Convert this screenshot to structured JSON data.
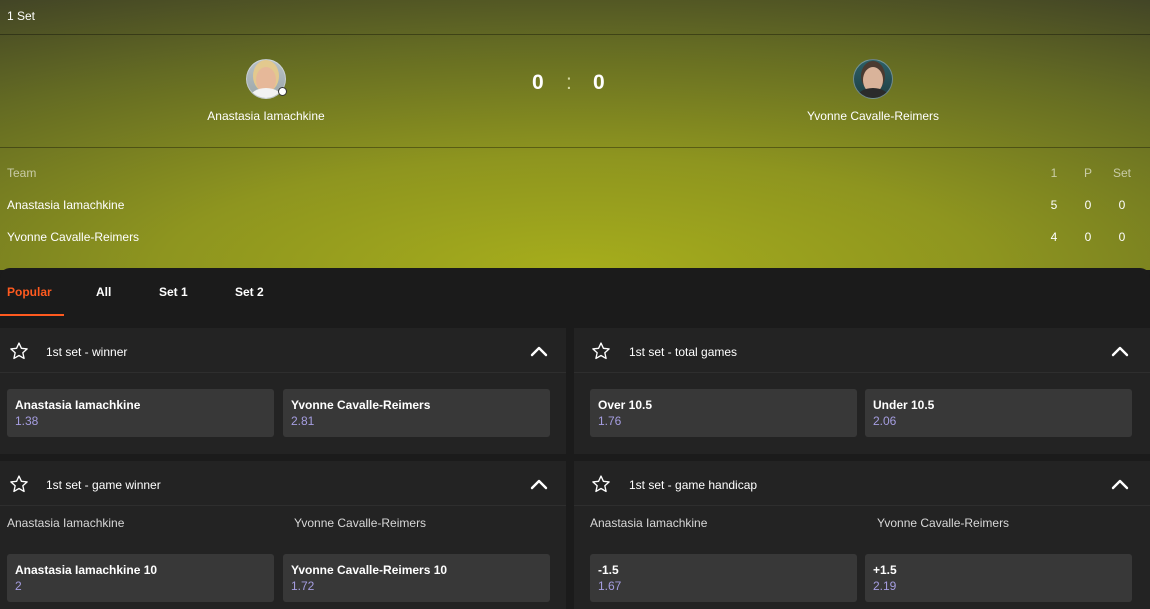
{
  "header": {
    "set_label": "1 Set",
    "home": {
      "name": "Anastasia Iamachkine",
      "score": "0"
    },
    "away": {
      "name": "Yvonne Cavalle-Reimers",
      "score": "0"
    },
    "separator": ":"
  },
  "scoreboard": {
    "headers": {
      "team": "Team",
      "c1": "1",
      "c2": "P",
      "c3": "Set"
    },
    "rows": [
      {
        "name": "Anastasia Iamachkine",
        "c1": "5",
        "c2": "0",
        "c3": "0"
      },
      {
        "name": "Yvonne Cavalle-Reimers",
        "c1": "4",
        "c2": "0",
        "c3": "0"
      }
    ]
  },
  "tabs": [
    {
      "label": "Popular",
      "active": true
    },
    {
      "label": "All"
    },
    {
      "label": "Set 1"
    },
    {
      "label": "Set 2"
    }
  ],
  "markets": {
    "winner": {
      "title": "1st set - winner",
      "options": [
        {
          "label": "Anastasia Iamachkine",
          "odds": "1.38"
        },
        {
          "label": "Yvonne Cavalle-Reimers",
          "odds": "2.81"
        }
      ]
    },
    "total_games": {
      "title": "1st set - total games",
      "options": [
        {
          "label": "Over 10.5",
          "odds": "1.76"
        },
        {
          "label": "Under 10.5",
          "odds": "2.06"
        }
      ]
    },
    "game_winner": {
      "title": "1st set - game winner",
      "col_home": "Anastasia Iamachkine",
      "col_away": "Yvonne Cavalle-Reimers",
      "options": [
        {
          "label": "Anastasia Iamachkine 10",
          "odds": "2"
        },
        {
          "label": "Yvonne Cavalle-Reimers 10",
          "odds": "1.72"
        }
      ]
    },
    "game_handicap": {
      "title": "1st set - game handicap",
      "col_home": "Anastasia Iamachkine",
      "col_away": "Yvonne Cavalle-Reimers",
      "options": [
        {
          "label": "-1.5",
          "odds": "1.67"
        },
        {
          "label": "+1.5",
          "odds": "2.19"
        }
      ]
    }
  },
  "colors": {
    "accent": "#ff5a1f",
    "odds": "#a59de0",
    "card": "#232323",
    "button": "#383838"
  },
  "icons": {
    "favorite": "star-outline-icon",
    "collapse": "chevron-up-icon"
  }
}
